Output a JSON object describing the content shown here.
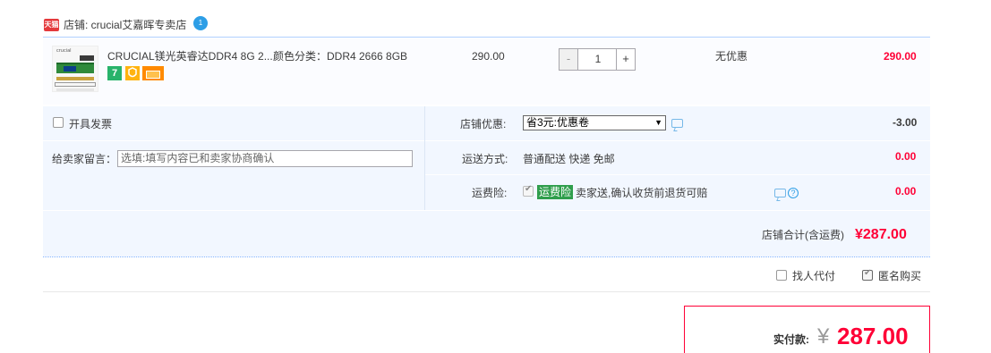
{
  "shop": {
    "badge": "天猫",
    "label": "店铺: crucial艾嘉晖专卖店",
    "wangwang_badge": "1"
  },
  "item": {
    "thumb_brand": "crucial",
    "title": "CRUCIAL镁光英睿达DDR4 8G 2...",
    "sku": "颜色分类：DDR4 2666 8GB",
    "service_icons": [
      "seven-day-return-icon",
      "guarantee-icon",
      "credit-card-icon"
    ],
    "service_7": "7",
    "price": "290.00",
    "quantity": "1",
    "minus": "-",
    "plus": "+",
    "promotion": "无优惠",
    "subtotal": "290.00"
  },
  "options": {
    "invoice_label": "开具发票",
    "memo_label": "给卖家留言：",
    "memo_placeholder": "选填:填写内容已和卖家协商确认",
    "coupon_label": "店铺优惠:",
    "coupon_selected": "省3元:优惠卷",
    "coupon_amount": "-3.00",
    "shipping_label": "运送方式:",
    "shipping_value": "普通配送 快递 免邮",
    "shipping_amount": "0.00",
    "insurance_label": "运费险:",
    "insurance_tag": "运费险",
    "insurance_desc": "卖家送,确认收货前退货可赔",
    "insurance_amount": "0.00"
  },
  "shop_total": {
    "label": "店铺合计(含运费)",
    "value": "¥287.00"
  },
  "extras": {
    "proxy_pay": "找人代付",
    "anonymous": "匿名购买",
    "anonymous_checked": true,
    "proxy_checked": false
  },
  "payment": {
    "label": "实付款:",
    "currency": "¥",
    "amount": "287.00"
  },
  "colors": {
    "accent_red": "#ff0036",
    "panel_blue": "#f2f7ff",
    "border_blue": "#b2d1ff"
  }
}
